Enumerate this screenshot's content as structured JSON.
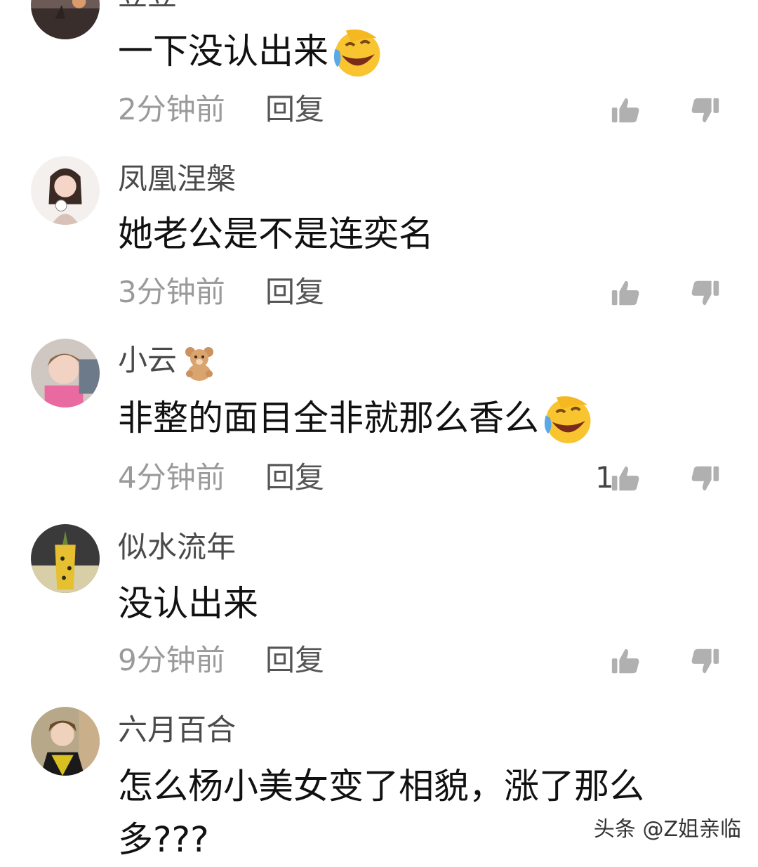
{
  "comments": [
    {
      "username": "豆豆",
      "text": "一下没认出来",
      "emoji": "laughing-tears-icon",
      "time": "2分钟前",
      "reply": "回复",
      "likes": ""
    },
    {
      "username": "凤凰涅槃",
      "text": "她老公是不是连奕名",
      "time": "3分钟前",
      "reply": "回复",
      "likes": ""
    },
    {
      "username": "小云",
      "username_icon": "teddy-bear-icon",
      "text": "非整的面目全非就那么香么",
      "emoji": "laughing-tears-icon",
      "time": "4分钟前",
      "reply": "回复",
      "likes": "1"
    },
    {
      "username": "似水流年",
      "text": "没认出来",
      "time": "9分钟前",
      "reply": "回复",
      "likes": ""
    },
    {
      "username": "六月百合",
      "text_line1": "怎么杨小美女变了相貌，涨了那么",
      "text_line2": "多???",
      "likes": ""
    }
  ],
  "watermark": "头条 @Z姐亲临",
  "colors": {
    "background": "#ffffff",
    "username": "#4a4a4a",
    "time": "#9a9a9a",
    "icon": "#b0b0b0"
  }
}
